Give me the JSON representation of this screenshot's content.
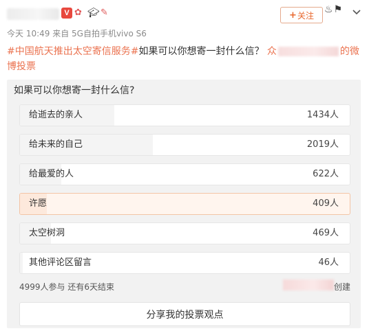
{
  "post": {
    "meta": "今天 10:49 来自 5G自拍手机vivo S6",
    "follow_label": "关注",
    "text_tag": "#中国航天推出太空寄信服务#",
    "text_body": "如果可以你想寄一封什么信？",
    "text_prefix_frag": "众",
    "text_suffix_frag": "的微",
    "text_line2": "博投票"
  },
  "poll": {
    "question": "如果可以你想寄一封什么信?",
    "options": [
      {
        "label": "给逝去的亲人",
        "count": "1434人",
        "votes": 1434,
        "selected": false
      },
      {
        "label": "给未来的自己",
        "count": "2019人",
        "votes": 2019,
        "selected": false
      },
      {
        "label": "给最爱的人",
        "count": "622人",
        "votes": 622,
        "selected": false
      },
      {
        "label": "许愿",
        "count": "409人",
        "votes": 409,
        "selected": true
      },
      {
        "label": "太空树洞",
        "count": "469人",
        "votes": 469,
        "selected": false
      },
      {
        "label": "其他评论区留言",
        "count": "46人",
        "votes": 46,
        "selected": false
      }
    ],
    "stats": "4999人参与 还有6天结束",
    "creator_suffix": "创建",
    "share_label": "分享我的投票观点"
  },
  "colors": {
    "accent": "#eb7350",
    "follow": "#e8672d",
    "badge_v": "#e8483e"
  },
  "icons": [
    "v-badge-icon",
    "award-icon",
    "graduation-cap-icon",
    "fan-icon",
    "plus-icon",
    "decoration-icons",
    "chevron-down-icon"
  ]
}
